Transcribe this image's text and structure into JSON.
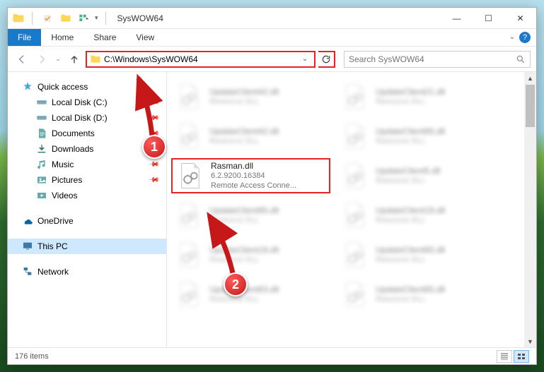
{
  "window": {
    "title": "SysWOW64",
    "controls": {
      "min": "—",
      "max": "☐",
      "close": "✕"
    }
  },
  "ribbon": {
    "file": "File",
    "home": "Home",
    "share": "Share",
    "view": "View",
    "help": "?",
    "expand": "⌄"
  },
  "nav": {
    "back": "←",
    "forward": "→",
    "recent_dd": "⌄",
    "up": "↑"
  },
  "address": {
    "path": "C:\\Windows\\SysWOW64",
    "dropdown": "⌄",
    "refresh": "↻"
  },
  "search": {
    "placeholder": "Search SysWOW64",
    "icon": "🔍"
  },
  "sidebar": {
    "quick_access": "Quick access",
    "local_c": "Local Disk (C:)",
    "local_d": "Local Disk (D:)",
    "documents": "Documents",
    "downloads": "Downloads",
    "music": "Music",
    "pictures": "Pictures",
    "videos": "Videos",
    "onedrive": "OneDrive",
    "this_pc": "This PC",
    "network": "Network"
  },
  "files": {
    "highlighted": {
      "name": "Rasman.dll",
      "version": "6.2.9200.16384",
      "desc": "Remote Access Conne..."
    },
    "blurred": [
      {
        "name": "UpdateClient42.dll",
        "desc": "Resource DLL"
      },
      {
        "name": "UpdateClient21.dll",
        "desc": "Resource DLL"
      },
      {
        "name": "UpdateClient42.dll",
        "desc": "Resource DLL"
      },
      {
        "name": "UpdateClient65.dll",
        "desc": "Resource DLL"
      },
      {
        "name": "UpdateClient5.dll",
        "desc": "Resource DLL"
      },
      {
        "name": "UpdateClient65.dll",
        "desc": "Resource DLL"
      },
      {
        "name": "UpdateClient19.dll",
        "desc": "Resource DLL"
      },
      {
        "name": "UpdateClient19.dll",
        "desc": "Resource DLL"
      },
      {
        "name": "UpdateClient65.dll",
        "desc": "Resource DLL"
      },
      {
        "name": "UpdateClient63.dll",
        "desc": "Resource DLL"
      },
      {
        "name": "UpdateClient65.dll",
        "desc": "Resource DLL"
      }
    ]
  },
  "status": {
    "count": "176 items"
  },
  "annotations": {
    "badge1": "1",
    "badge2": "2"
  }
}
